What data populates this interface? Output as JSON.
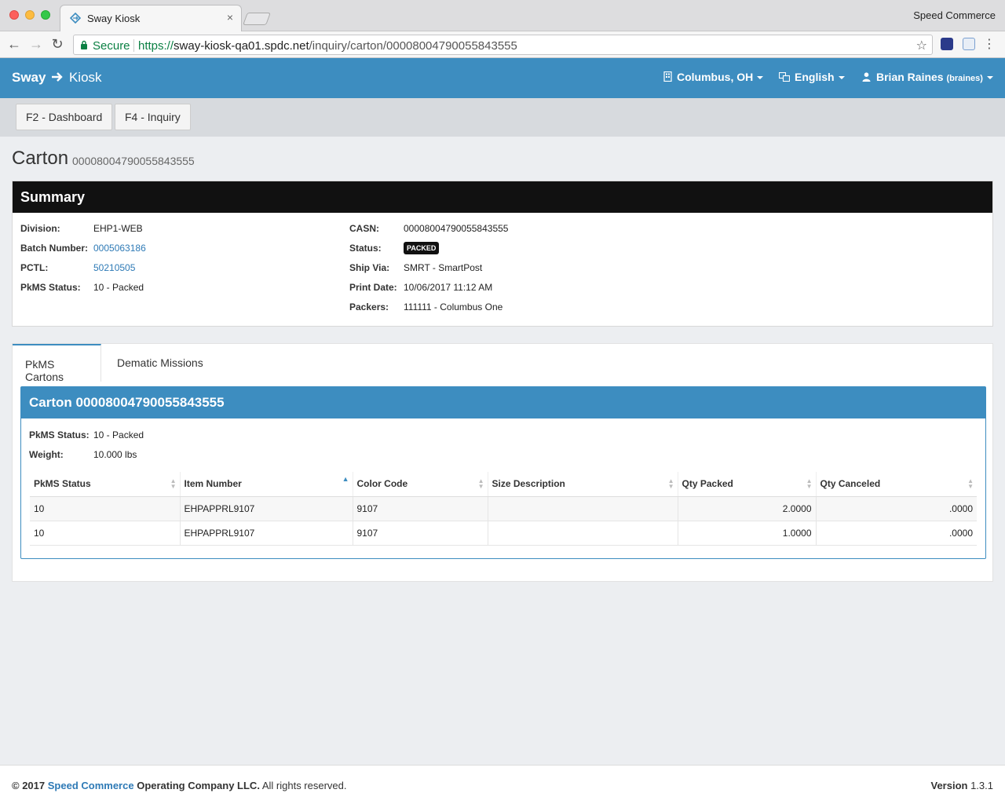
{
  "browser": {
    "tab_title": "Sway Kiosk",
    "tab_close": "×",
    "profile_name": "Speed Commerce",
    "secure_label": "Secure",
    "url_scheme": "https://",
    "url_host": "sway-kiosk-qa01.spdc.net",
    "url_path": "/inquiry/carton/00008004790055843555",
    "back_icon": "←",
    "forward_icon": "→",
    "reload_icon": "↻",
    "star_icon": "☆",
    "menu_icon": "⋮"
  },
  "header": {
    "brand_left": "Sway",
    "brand_right": "Kiosk",
    "location": "Columbus, OH",
    "language": "English",
    "user_name": "Brian Raines",
    "user_login": "(braines)"
  },
  "shortcuts": {
    "dashboard": "F2 - Dashboard",
    "inquiry": "F4 - Inquiry"
  },
  "page": {
    "title": "Carton",
    "subtitle": "00008004790055843555"
  },
  "summary": {
    "heading": "Summary",
    "division_label": "Division:",
    "division": "EHP1-WEB",
    "batch_label": "Batch Number:",
    "batch": "0005063186",
    "pctl_label": "PCTL:",
    "pctl": "50210505",
    "pkms_status_label": "PkMS Status:",
    "pkms_status": "10 - Packed",
    "casn_label": "CASN:",
    "casn": "00008004790055843555",
    "status_label": "Status:",
    "status": "PACKED",
    "ship_via_label": "Ship Via:",
    "ship_via": "SMRT - SmartPost",
    "print_date_label": "Print Date:",
    "print_date": "10/06/2017 11:12 AM",
    "packers_label": "Packers:",
    "packers": "111111 - Columbus One"
  },
  "tabs": {
    "pkms_cartons": "PkMS Cartons",
    "dematic_missions": "Dematic Missions"
  },
  "carton": {
    "heading": "Carton 00008004790055843555",
    "pkms_status_label": "PkMS Status:",
    "pkms_status": "10 - Packed",
    "weight_label": "Weight:",
    "weight": "10.000 lbs"
  },
  "grid": {
    "headers": [
      "PkMS Status",
      "Item Number",
      "Color Code",
      "Size Description",
      "Qty Packed",
      "Qty Canceled"
    ],
    "rows": [
      [
        "10",
        "EHPAPPRL9107",
        "9107",
        "",
        "2.0000",
        ".0000"
      ],
      [
        "10",
        "EHPAPPRL9107",
        "9107",
        "",
        "1.0000",
        ".0000"
      ]
    ]
  },
  "footer": {
    "copyright_prefix": "© 2017",
    "company_link": "Speed Commerce",
    "company_rest": "Operating Company LLC.",
    "rights": "All rights reserved.",
    "version_label": "Version",
    "version": "1.3.1"
  },
  "colors": {
    "primary": "#3d8dc0",
    "summary_header": "#111111",
    "link": "#2e7ab6",
    "secure_green": "#0b8043"
  }
}
